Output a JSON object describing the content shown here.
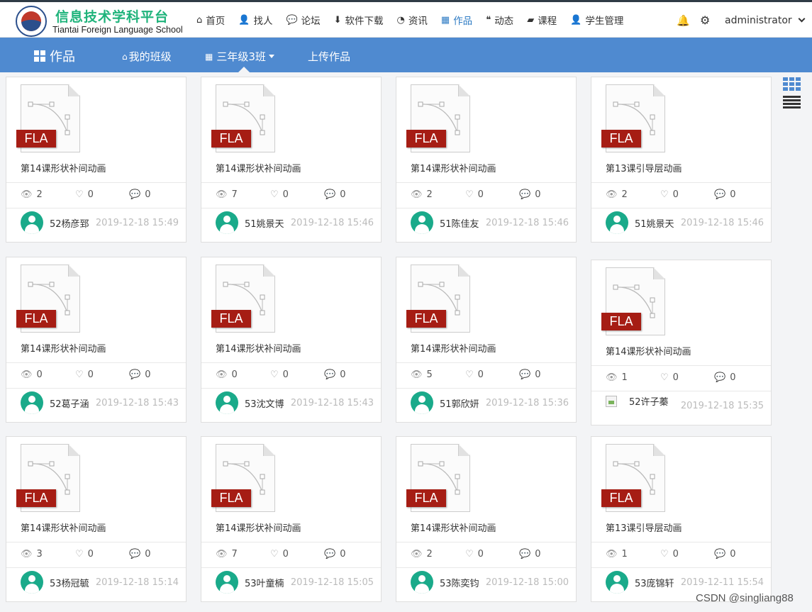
{
  "logo": {
    "cn": "信息技术学科平台",
    "en": "Tiantai Foreign Language School"
  },
  "nav": [
    {
      "icon": "home-icon",
      "glyph": "⌂",
      "label": "首页"
    },
    {
      "icon": "user-icon",
      "glyph": "👤",
      "label": "找人"
    },
    {
      "icon": "comments-icon",
      "glyph": "💬",
      "label": "论坛"
    },
    {
      "icon": "download-icon",
      "glyph": "⬇",
      "label": "软件下载"
    },
    {
      "icon": "rss-icon",
      "glyph": "◔",
      "label": "资讯"
    },
    {
      "icon": "grid-icon",
      "glyph": "▦",
      "label": "作品"
    },
    {
      "icon": "quote-icon",
      "glyph": "❝",
      "label": "动态"
    },
    {
      "icon": "book-icon",
      "glyph": "▰",
      "label": "课程"
    },
    {
      "icon": "student-icon",
      "glyph": "👤",
      "label": "学生管理"
    }
  ],
  "header_right": {
    "admin": "administrator"
  },
  "subnav": {
    "title": "作品",
    "my_class": "我的班级",
    "class": "三年级3班",
    "upload": "上传作品"
  },
  "badge": "FLA",
  "works": [
    {
      "title": "第14课形状补间动画",
      "views": "2",
      "likes": "0",
      "comments": "0",
      "author": "52杨彦郅",
      "time": "2019-12-18 15:49"
    },
    {
      "title": "第14课形状补间动画",
      "views": "7",
      "likes": "0",
      "comments": "0",
      "author": "51姚景天",
      "time": "2019-12-18 15:46"
    },
    {
      "title": "第14课形状补间动画",
      "views": "2",
      "likes": "0",
      "comments": "0",
      "author": "51陈佳友",
      "time": "2019-12-18 15:46"
    },
    {
      "title": "第13课引导层动画",
      "views": "2",
      "likes": "0",
      "comments": "0",
      "author": "51姚景天",
      "time": "2019-12-18 15:46"
    },
    {
      "title": "第14课形状补间动画",
      "views": "0",
      "likes": "0",
      "comments": "0",
      "author": "52葛子涵",
      "time": "2019-12-18 15:43"
    },
    {
      "title": "第14课形状补间动画",
      "views": "0",
      "likes": "0",
      "comments": "0",
      "author": "53沈文博",
      "time": "2019-12-18 15:43"
    },
    {
      "title": "第14课形状补间动画",
      "views": "5",
      "likes": "0",
      "comments": "0",
      "author": "51郭欣妍",
      "time": "2019-12-18 15:36"
    },
    {
      "title": "第14课形状补间动画",
      "views": "1",
      "likes": "0",
      "comments": "0",
      "author": "52许子蓁",
      "time": "2019-12-18 15:35",
      "broken_avatar": true
    },
    {
      "title": "第14课形状补间动画",
      "views": "3",
      "likes": "0",
      "comments": "0",
      "author": "53杨冠毓",
      "time": "2019-12-18 15:14"
    },
    {
      "title": "第14课形状补间动画",
      "views": "7",
      "likes": "0",
      "comments": "0",
      "author": "53叶童楠",
      "time": "2019-12-18 15:05"
    },
    {
      "title": "第14课形状补间动画",
      "views": "2",
      "likes": "0",
      "comments": "0",
      "author": "53陈奕钧",
      "time": "2019-12-18 15:00"
    },
    {
      "title": "第13课引导层动画",
      "views": "1",
      "likes": "0",
      "comments": "0",
      "author": "53庞锦轩",
      "time": "2019-12-11 15:54"
    }
  ],
  "watermark": "CSDN @singliang88",
  "colors": {
    "accent": "#4f8ad0",
    "active_nav": "#2f7cc4",
    "logo_green": "#1fb37b",
    "fla_badge": "#a61d14",
    "avatar": "#1aaa8a"
  }
}
